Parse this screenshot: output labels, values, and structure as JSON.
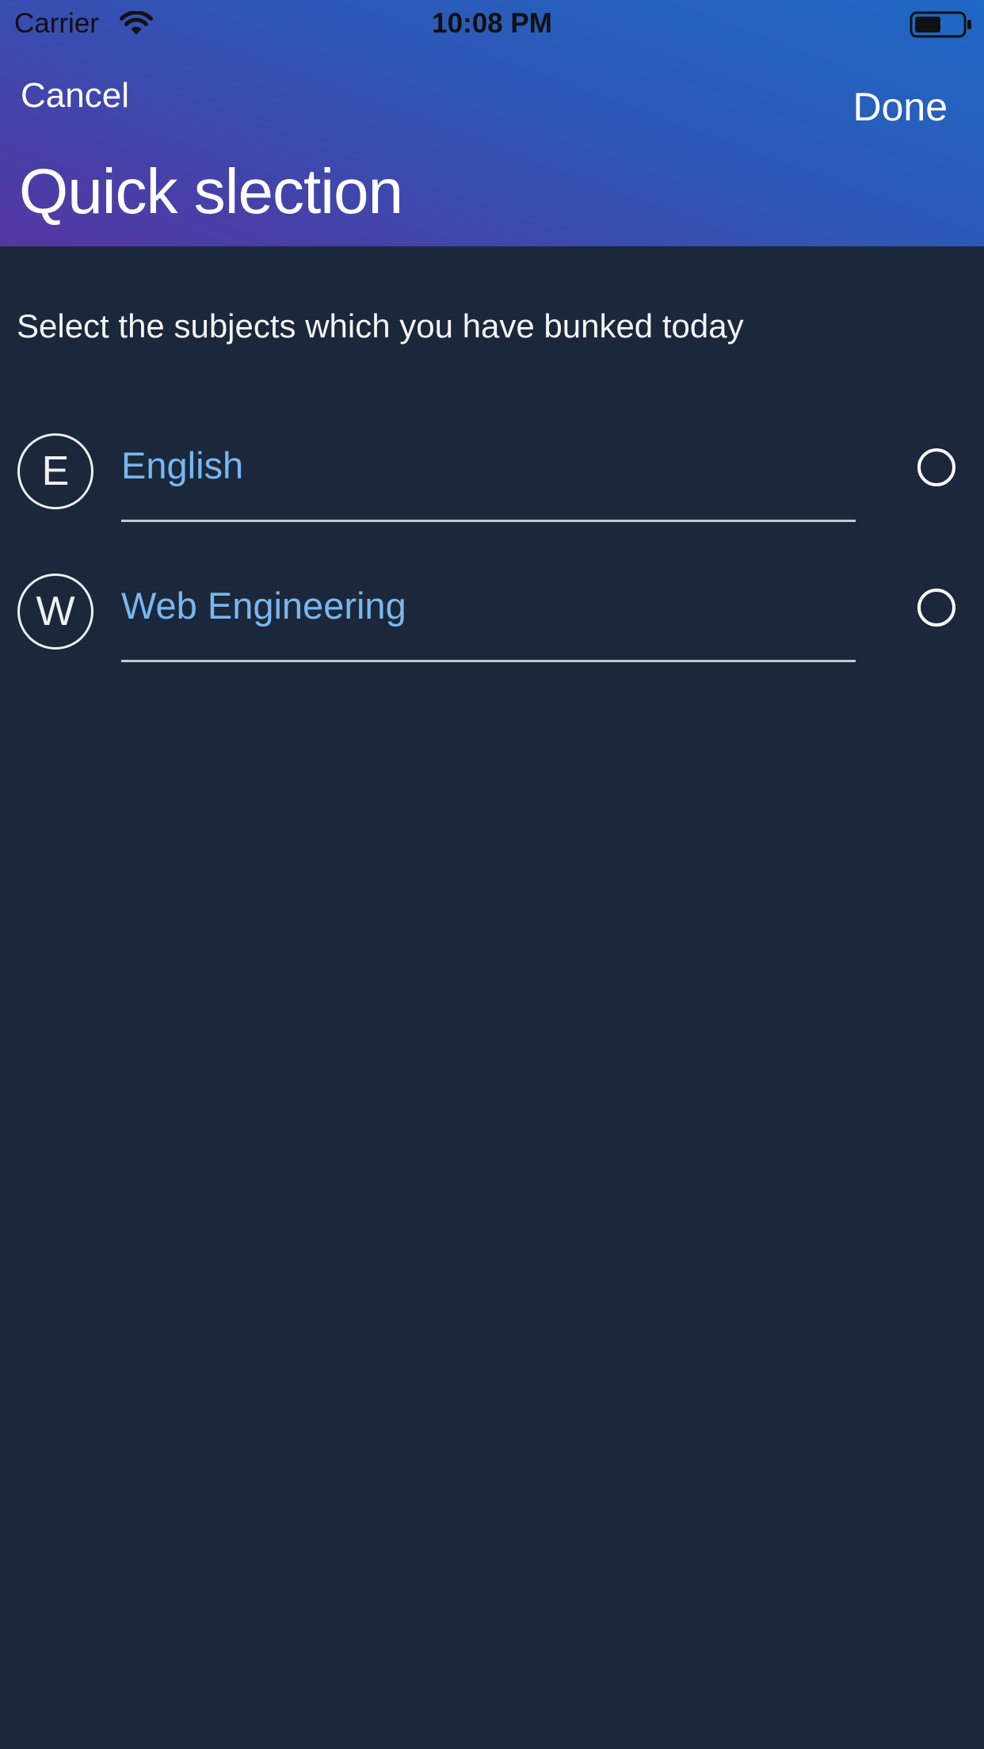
{
  "status_bar": {
    "carrier": "Carrier",
    "time": "10:08 PM",
    "wifi_icon": "wifi-icon",
    "battery_icon": "battery-icon"
  },
  "nav": {
    "cancel_label": "Cancel",
    "done_label": "Done",
    "title": "Quick slection"
  },
  "instruction": "Select the subjects which you have bunked today",
  "subjects": [
    {
      "initial": "E",
      "name": "English",
      "selected": false
    },
    {
      "initial": "W",
      "name": "Web Engineering",
      "selected": false
    }
  ],
  "colors": {
    "background": "#1b283b",
    "header_gradient_start": "#1f68c4",
    "header_gradient_end": "#5637a4",
    "subject_name": "#79b7f0",
    "divider": "#c6c9ce"
  }
}
